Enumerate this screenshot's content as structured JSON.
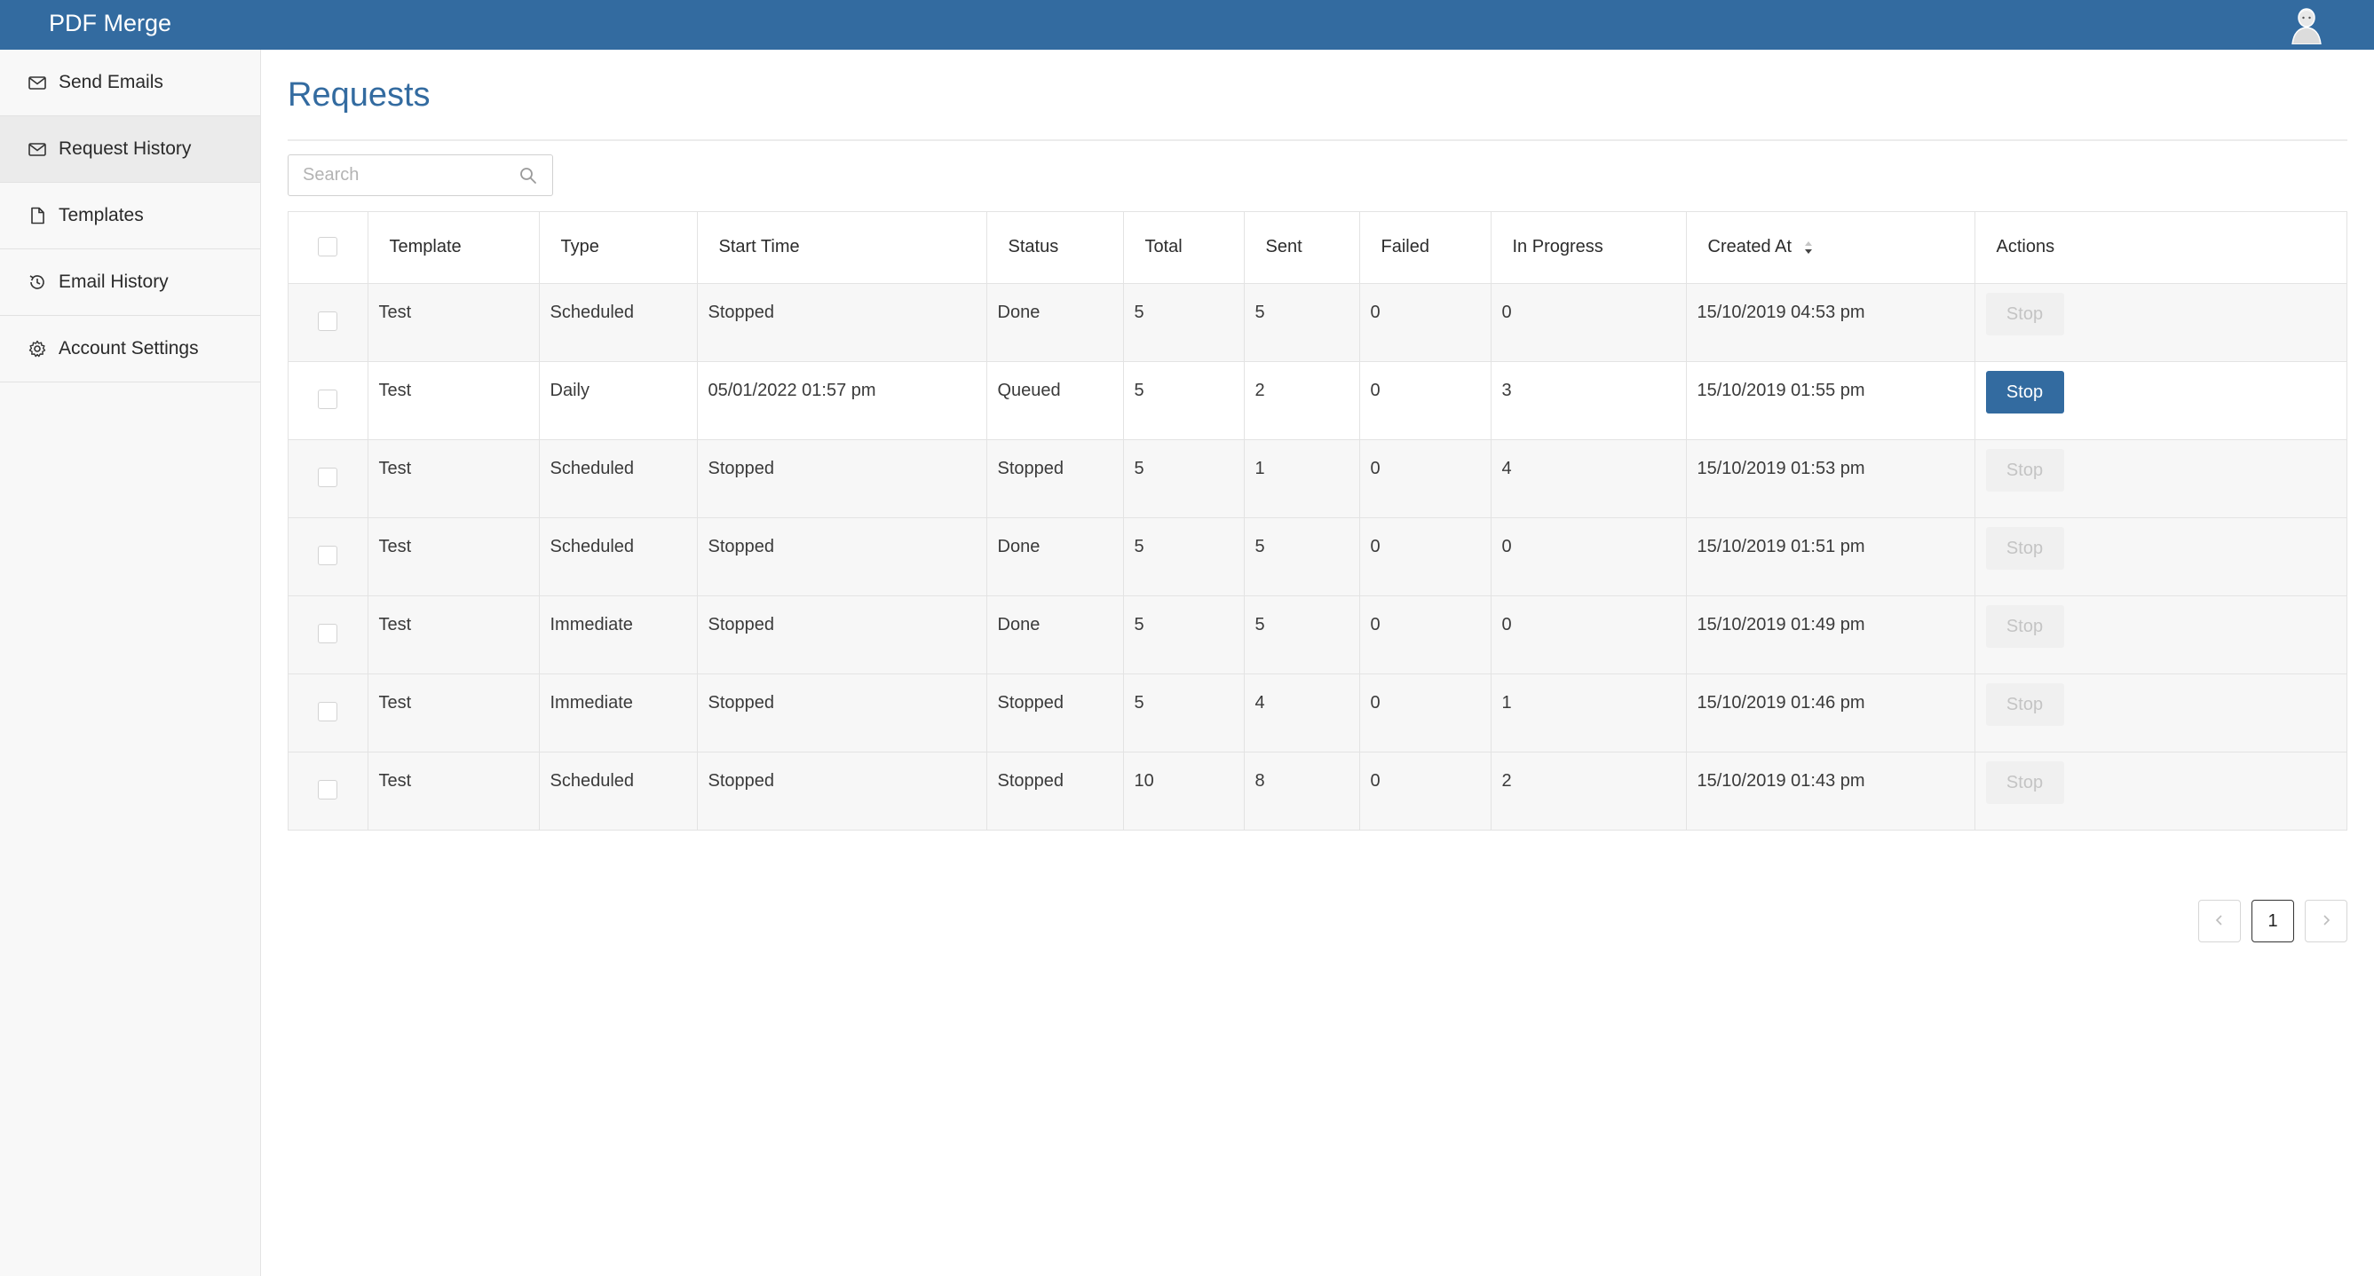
{
  "app": {
    "title": "PDF Merge"
  },
  "sidebar": {
    "items": [
      {
        "label": "Send Emails",
        "icon": "mail-icon",
        "active": false
      },
      {
        "label": "Request History",
        "icon": "mail-icon",
        "active": true
      },
      {
        "label": "Templates",
        "icon": "file-icon",
        "active": false
      },
      {
        "label": "Email History",
        "icon": "history-icon",
        "active": false
      },
      {
        "label": "Account Settings",
        "icon": "gear-icon",
        "active": false
      }
    ]
  },
  "main": {
    "title": "Requests",
    "search": {
      "placeholder": "Search",
      "value": ""
    }
  },
  "table": {
    "columns": [
      "Template",
      "Type",
      "Start Time",
      "Status",
      "Total",
      "Sent",
      "Failed",
      "In Progress",
      "Created At",
      "Actions"
    ],
    "sort": {
      "column": "Created At"
    },
    "rows": [
      {
        "template": "Test",
        "type": "Scheduled",
        "start_time": "Stopped",
        "status": "Done",
        "total": "5",
        "sent": "5",
        "failed": "0",
        "in_progress": "0",
        "created_at": "15/10/2019 04:53 pm",
        "action": "Stop",
        "action_enabled": false
      },
      {
        "template": "Test",
        "type": "Daily",
        "start_time": "05/01/2022 01:57 pm",
        "status": "Queued",
        "total": "5",
        "sent": "2",
        "failed": "0",
        "in_progress": "3",
        "created_at": "15/10/2019 01:55 pm",
        "action": "Stop",
        "action_enabled": true
      },
      {
        "template": "Test",
        "type": "Scheduled",
        "start_time": "Stopped",
        "status": "Stopped",
        "total": "5",
        "sent": "1",
        "failed": "0",
        "in_progress": "4",
        "created_at": "15/10/2019 01:53 pm",
        "action": "Stop",
        "action_enabled": false
      },
      {
        "template": "Test",
        "type": "Scheduled",
        "start_time": "Stopped",
        "status": "Done",
        "total": "5",
        "sent": "5",
        "failed": "0",
        "in_progress": "0",
        "created_at": "15/10/2019 01:51 pm",
        "action": "Stop",
        "action_enabled": false
      },
      {
        "template": "Test",
        "type": "Immediate",
        "start_time": "Stopped",
        "status": "Done",
        "total": "5",
        "sent": "5",
        "failed": "0",
        "in_progress": "0",
        "created_at": "15/10/2019 01:49 pm",
        "action": "Stop",
        "action_enabled": false
      },
      {
        "template": "Test",
        "type": "Immediate",
        "start_time": "Stopped",
        "status": "Stopped",
        "total": "5",
        "sent": "4",
        "failed": "0",
        "in_progress": "1",
        "created_at": "15/10/2019 01:46 pm",
        "action": "Stop",
        "action_enabled": false
      },
      {
        "template": "Test",
        "type": "Scheduled",
        "start_time": "Stopped",
        "status": "Stopped",
        "total": "10",
        "sent": "8",
        "failed": "0",
        "in_progress": "2",
        "created_at": "15/10/2019 01:43 pm",
        "action": "Stop",
        "action_enabled": false
      }
    ]
  },
  "pagination": {
    "current_page": "1",
    "prev_icon": "chevron-left-icon",
    "next_icon": "chevron-right-icon"
  },
  "colors": {
    "brand": "#336ba0",
    "sidebar_bg": "#f8f8f8",
    "row_bg": "#f7f7f7"
  }
}
